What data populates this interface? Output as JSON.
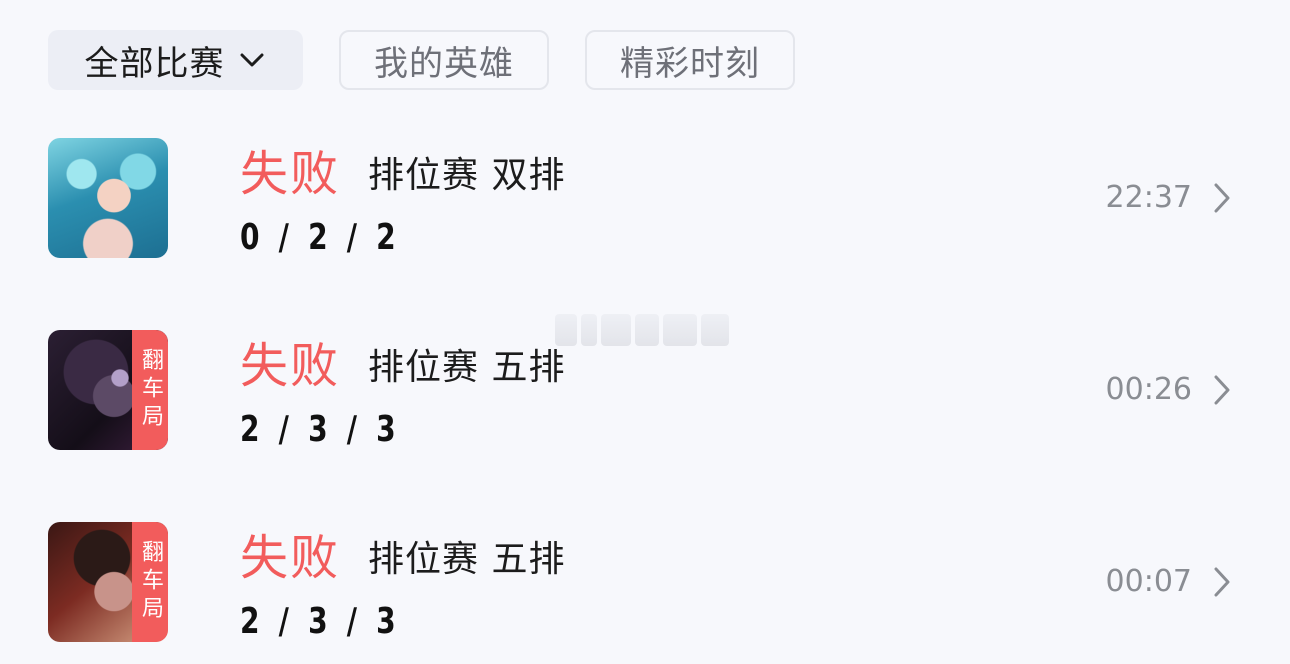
{
  "filters": {
    "all_matches": "全部比赛",
    "my_heroes": "我的英雄",
    "highlights": "精彩时刻"
  },
  "matches": [
    {
      "result": "失败",
      "mode": "排位赛 双排",
      "kda": "0 / 2 / 2",
      "time": "22:37",
      "tag": ""
    },
    {
      "result": "失败",
      "mode": "排位赛 五排",
      "kda": "2 / 3 / 3",
      "time": "00:26",
      "tag": "翻车局"
    },
    {
      "result": "失败",
      "mode": "排位赛 五排",
      "kda": "2 / 3 / 3",
      "time": "00:07",
      "tag": "翻车局"
    }
  ],
  "icons": {
    "dropdown": "chevron-down-icon",
    "row_arrow": "chevron-right-icon"
  },
  "colors": {
    "accent_red": "#f25c5c",
    "text_primary": "#1c1c1c",
    "text_secondary": "#8a8d93",
    "background": "#f7f8fc"
  }
}
